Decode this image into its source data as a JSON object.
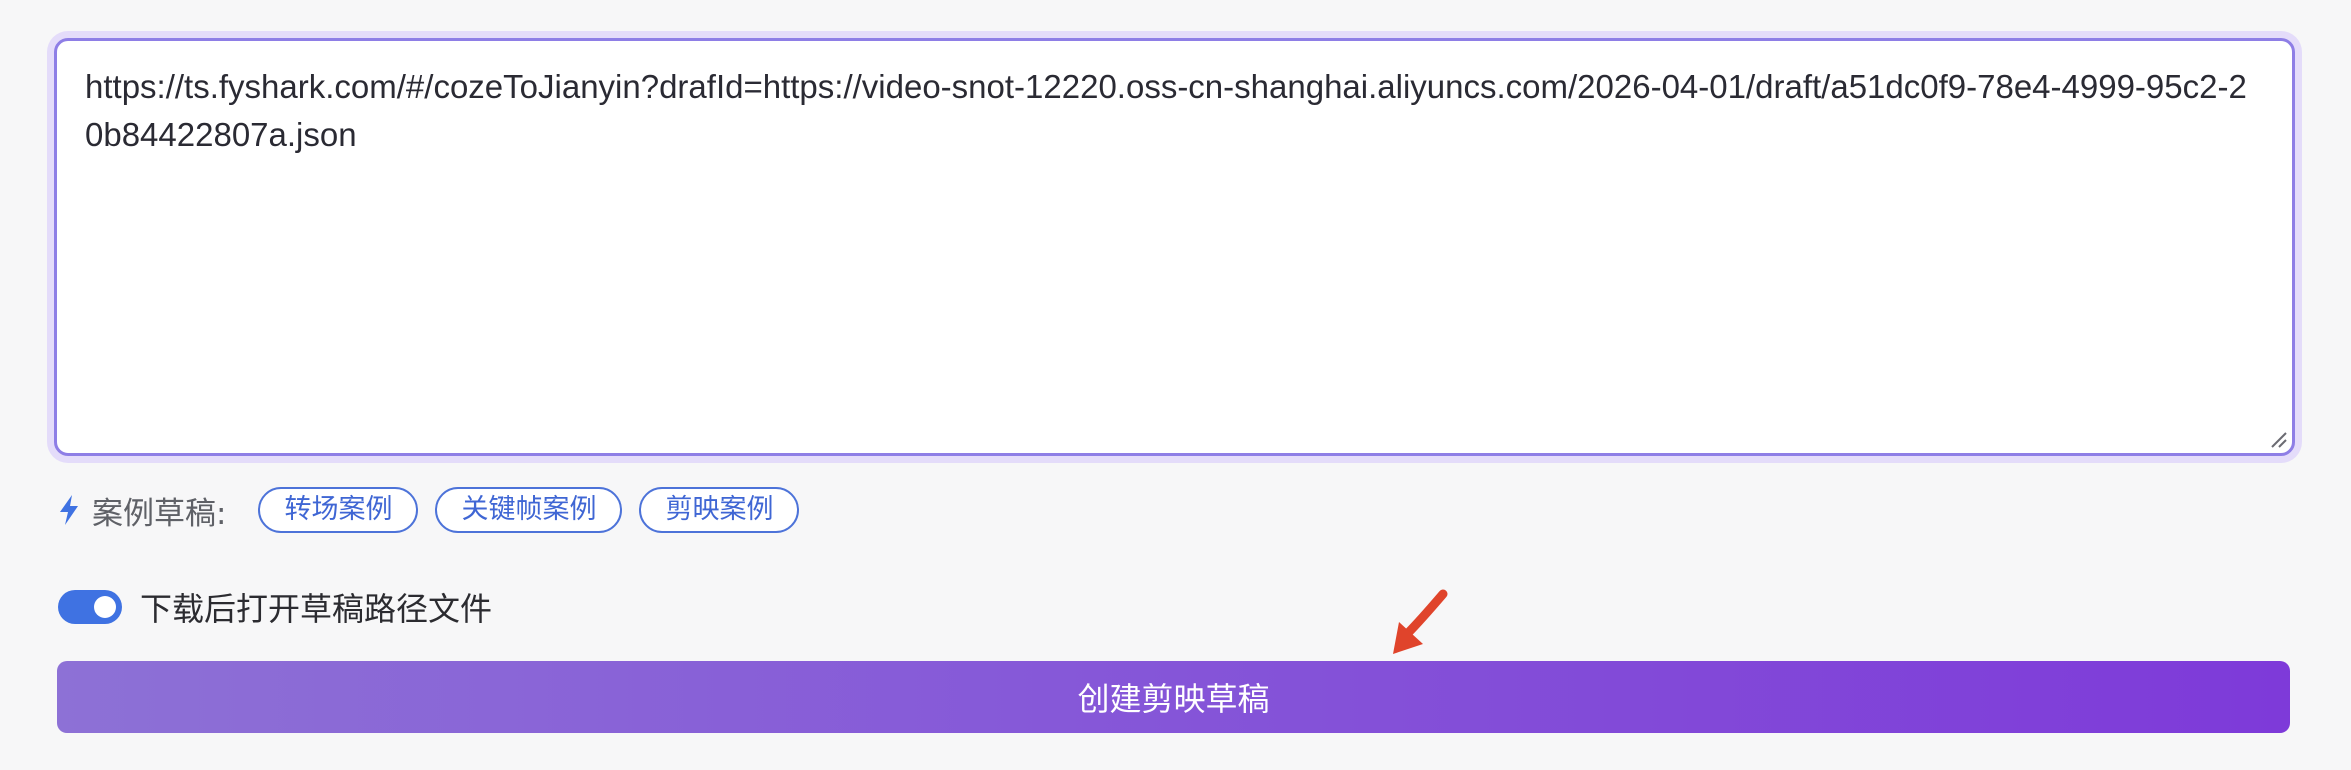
{
  "url_input": {
    "value": "https://ts.fyshark.com/#/cozeToJianyin?drafId=https://video-snot-12220.oss-cn-shanghai.aliyuncs.com/2026-04-01/draft/a51dc0f9-78e4-4999-95c2-20b84422807a.json"
  },
  "samples": {
    "icon": "lightning-bolt-icon",
    "label": "案例草稿:",
    "chips": [
      {
        "label": "转场案例"
      },
      {
        "label": "关键帧案例"
      },
      {
        "label": "剪映案例"
      }
    ]
  },
  "download_option": {
    "enabled": true,
    "label": "下载后打开草稿路径文件"
  },
  "create_button": {
    "label": "创建剪映草稿"
  },
  "annotation": {
    "icon": "red-arrow-icon",
    "color": "#e0442b"
  },
  "colors": {
    "accent_blue": "#3f72e2",
    "chip_blue": "#3f66d4",
    "focus_border": "#8e7ee6",
    "button_gradient_start": "#8d71d6",
    "button_gradient_end": "#7e3ad9"
  }
}
